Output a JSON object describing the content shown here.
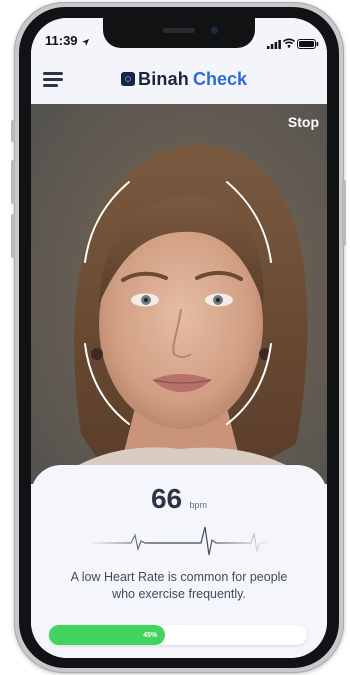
{
  "status_bar": {
    "time": "11:39"
  },
  "app": {
    "brand_left": "Binah",
    "brand_right": "Check",
    "brand_color": "#2c6bd8"
  },
  "camera": {
    "stop_label": "Stop"
  },
  "measurement": {
    "value": "66",
    "unit": "bpm",
    "message": "A low Heart Rate is common for people who exercise frequently."
  },
  "progress": {
    "percent": 45,
    "label": "45%",
    "color": "#43d460"
  }
}
